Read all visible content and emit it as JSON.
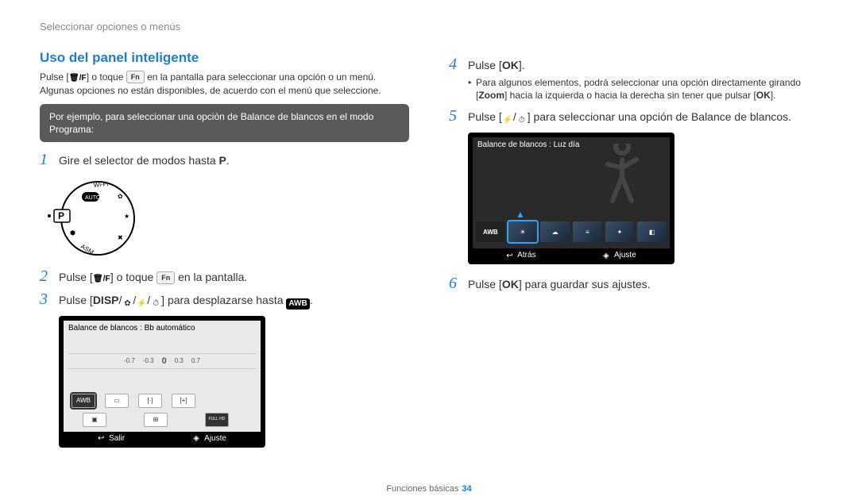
{
  "header": {
    "breadcrumb": "Seleccionar opciones o menús"
  },
  "section": {
    "title": "Uso del panel inteligente"
  },
  "intro": {
    "line1_a": "Pulse [",
    "line1_b": "] o toque ",
    "line1_c": " en la pantalla para seleccionar una opción o un menú.",
    "line2": "Algunas opciones no están disponibles, de acuerdo con el menú que seleccione."
  },
  "callout": {
    "text": "Por ejemplo, para seleccionar una opción de Balance de blancos en el modo Programa:"
  },
  "labels": {
    "fn_key": "Fn",
    "trash_fn": "🗑/Fn",
    "p_mode": "P",
    "ok": "OK",
    "disp": "DISP",
    "zoom": "Zoom",
    "awb": "AWB",
    "full_hd": "FULL HD"
  },
  "steps": {
    "s1": {
      "num": "1",
      "text_a": "Gire el selector de modos hasta ",
      "text_b": "."
    },
    "s2": {
      "num": "2",
      "text_a": "Pulse [",
      "text_b": "] o toque ",
      "text_c": " en la pantalla."
    },
    "s3": {
      "num": "3",
      "text_a": "Pulse [",
      "text_b": "] para desplazarse hasta ",
      "text_c": "."
    },
    "s4": {
      "num": "4",
      "text_a": "Pulse [",
      "text_b": "]."
    },
    "s4_note_a": "Para algunos elementos, podrá seleccionar una opción directamente girando [",
    "s4_note_b": "] hacia la izquierda o hacia la derecha sin tener que pulsar [",
    "s4_note_c": "].",
    "s5": {
      "num": "5",
      "text_a": "Pulse [",
      "text_b": "] para seleccionar una opción de Balance de blancos."
    },
    "s6": {
      "num": "6",
      "text_a": "Pulse [",
      "text_b": "] para guardar sus ajustes."
    }
  },
  "panel3": {
    "title": "Balance de blancos : Bb automático",
    "ruler": [
      "-0.7",
      "-0.3",
      "0",
      "0.3",
      "0.7"
    ],
    "footer_left": "Salir",
    "footer_right": "Ajuste"
  },
  "panel5": {
    "title": "Balance de blancos : Luz día",
    "footer_left": "Atrás",
    "footer_right": "Ajuste"
  },
  "footer": {
    "section": "Funciones básicas",
    "page": "34"
  }
}
